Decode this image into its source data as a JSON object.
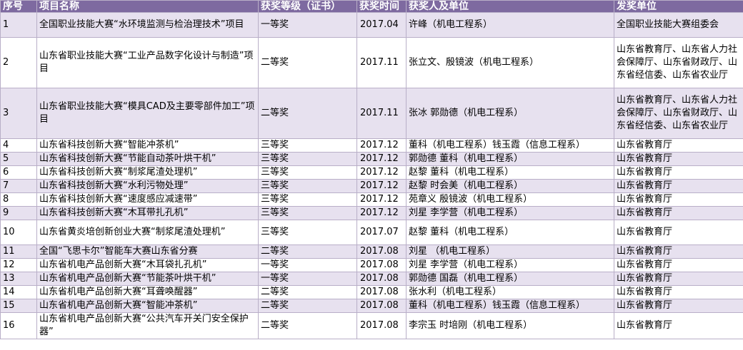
{
  "table": {
    "headers": [
      "序号",
      "项目名称",
      "获奖等级（证书）",
      "获奖时间",
      "获奖人及单位",
      "发奖单位"
    ],
    "rows": [
      {
        "no": "1",
        "name": "全国职业技能大赛“水环境监测与检治理技术”项目",
        "level": "一等奖",
        "date": "2017.04",
        "winner": "许峰（机电工程系）",
        "issuer": "全国职业技能大赛组委会"
      },
      {
        "no": "2",
        "name": "山东省职业技能大赛“工业产品数字化设计与制造”项目",
        "level": "二等奖",
        "date": "2017.11",
        "winner": "张立文、殷镜波（机电工程系）",
        "issuer": "山东省教育厅、山东省人力社会保障厅、山东省财政厅、山东省经信委、山东省农业厅"
      },
      {
        "no": "3",
        "name": "山东省职业技能大赛“模具CAD及主要零部件加工”项目",
        "level": "二等奖",
        "date": "2017.11",
        "winner": "张冰 郭勋德（机电工程系）",
        "issuer": "山东省教育厅、山东省人力社会保障厅、山东省财政厅、山东省经信委、山东省农业厅"
      },
      {
        "no": "4",
        "name": "山东省科技创新大赛“智能冲茶机”",
        "level": "三等奖",
        "date": "2017.12",
        "winner": "董科（机电工程系）钱玉霞（信息工程系）",
        "issuer": "山东省教育厅"
      },
      {
        "no": "5",
        "name": "山东省科技创新大赛“节能自动茶叶烘干机”",
        "level": "三等奖",
        "date": "2017.12",
        "winner": "郭勋德 董科（机电工程系）",
        "issuer": "山东省教育厅"
      },
      {
        "no": "6",
        "name": "山东省科技创新大赛“制浆尾渣处理机”",
        "level": "三等奖",
        "date": "2017.12",
        "winner": "赵黎 董科（机电工程系）",
        "issuer": "山东省教育厅"
      },
      {
        "no": "7",
        "name": "山东省科技创新大赛“水利污物处理”",
        "level": "三等奖",
        "date": "2017.12",
        "winner": "赵黎 时会美（机电工程系）",
        "issuer": "山东省教育厅"
      },
      {
        "no": "8",
        "name": "山东省科技创新大赛“速度感应减速带”",
        "level": "三等奖",
        "date": "2017.12",
        "winner": "苑章义 殷镜波（机电工程系）",
        "issuer": "山东省教育厅"
      },
      {
        "no": "9",
        "name": "山东省科技创新大赛“木耳带扎孔机”",
        "level": "三等奖",
        "date": "2017.12",
        "winner": "刘星 李学营（机电工程系）",
        "issuer": "山东省教育厅"
      },
      {
        "no": "10",
        "name": "山东省黄炎培创新创业大赛“制浆尾渣处理机”",
        "level": "三等奖",
        "date": "2017.07",
        "winner": "赵黎 董科（机电工程系）",
        "issuer": "山东省教育厅"
      },
      {
        "no": "11",
        "name": "全国“飞思卡尔”智能车大赛山东省分赛",
        "level": "二等奖",
        "date": "2017.08",
        "winner": "刘星 （机电工程系）",
        "issuer": "山东省教育厅"
      },
      {
        "no": "12",
        "name": "山东省机电产品创新大赛“木耳袋扎孔机”",
        "level": "一等奖",
        "date": "2017.08",
        "winner": "刘星 李学营（机电工程系）",
        "issuer": "山东省教育厅"
      },
      {
        "no": "13",
        "name": "山东省机电产品创新大赛“节能茶叶烘干机”",
        "level": "一等奖",
        "date": "2017.08",
        "winner": "郭勋德 国磊（机电工程系）",
        "issuer": "山东省教育厅"
      },
      {
        "no": "14",
        "name": "山东省机电产品创新大赛“耳聋唤醒器”",
        "level": "二等奖",
        "date": "2017.08",
        "winner": "张水利（机电工程系）",
        "issuer": "山东省教育厅"
      },
      {
        "no": "15",
        "name": "山东省机电产品创新大赛“智能冲茶机”",
        "level": "二等奖",
        "date": "2017.08",
        "winner": "董科（机电工程系）钱玉霞（信息工程系）",
        "issuer": "山东省教育厅"
      },
      {
        "no": "16",
        "name": "山东省机电产品创新大赛“公共汽车开关门安全保护器”",
        "level": "二等奖",
        "date": "2017.08",
        "winner": "李宗玉 时培刚（机电工程系）",
        "issuer": "山东省教育厅"
      }
    ]
  },
  "colors": {
    "header_bg": "#7e6aa0",
    "shaded_row_bg": "#e7e1ef",
    "grid": "#b9afc8"
  }
}
